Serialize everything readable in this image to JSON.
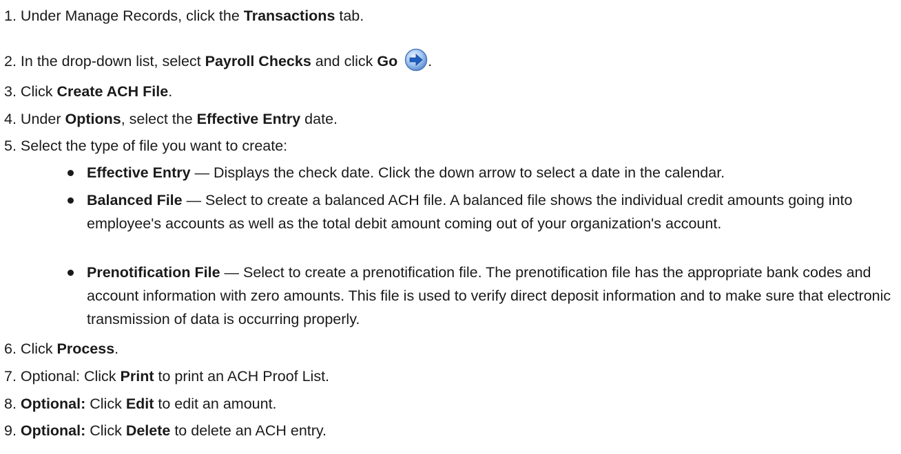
{
  "steps": [
    {
      "n": "1.",
      "t1": "Under Manage Records, click the ",
      "b1": "Transactions",
      "t2": " tab."
    },
    {
      "n": "2.",
      "t1": "In the drop-down list, select ",
      "b1": "Payroll Checks",
      "t2": " and click ",
      "b2": "Go",
      "t3": "."
    },
    {
      "n": "3.",
      "t1": "Click ",
      "b1": "Create ACH File",
      "t2": "."
    },
    {
      "n": "4.",
      "t1": "Under ",
      "b1": "Options",
      "t2": ", select the ",
      "b2": "Effective Entry",
      "t3": " date."
    },
    {
      "n": "5.",
      "t1": "Select the type of file you want to create:"
    },
    {
      "n": "6.",
      "t1": "Click ",
      "b1": "Process",
      "t2": "."
    },
    {
      "n": "7.",
      "t1": "Optional: Click ",
      "b1": "Print",
      "t2": " to print an ACH Proof List."
    },
    {
      "n": "8.",
      "b1": "Optional:",
      "t1": " Click ",
      "b2": "Edit",
      "t2": " to edit an amount."
    },
    {
      "n": "9.",
      "b1": "Optional:",
      "t1": " Click ",
      "b2": "Delete",
      "t2": " to delete an ACH entry."
    }
  ],
  "file_types": [
    {
      "name": "Effective Entry",
      "desc": " — Displays the check date. Click the down arrow to select a date in the calendar."
    },
    {
      "name": "Balanced File",
      "desc": " — Select to create a balanced ACH file. A balanced file shows the individual credit amounts going into employee's accounts as well as the total debit amount coming out of your organization's account."
    },
    {
      "name": "Prenotification File",
      "desc": " — Select to create a prenotification file. The prenotification file has the appropriate bank codes and account information with zero amounts. This file is used to verify direct deposit information and to make sure that electronic transmission of data is occurring properly."
    }
  ],
  "icons": {
    "go": "go-arrow-icon",
    "bullet": "bullet-icon"
  },
  "colors": {
    "text": "#1a1a1a",
    "go_icon": "#2a6fd6"
  }
}
